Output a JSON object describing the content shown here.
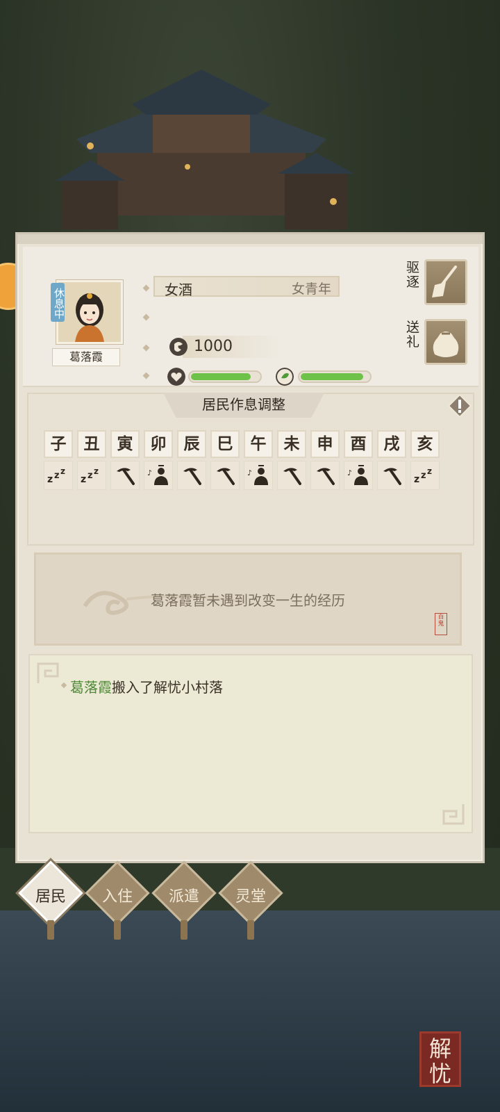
{
  "resident": {
    "status_tag": "休息中",
    "name": "葛落霞",
    "occupation": "女酒",
    "age_gender": "女青年",
    "coins": "1000",
    "health_fraction": 0.88,
    "mood_fraction": 0.92
  },
  "actions": {
    "expel_label": "驱逐",
    "gift_label": "送礼"
  },
  "schedule": {
    "title": "居民作息调整",
    "hours": [
      {
        "label": "子",
        "activity": "sleep"
      },
      {
        "label": "丑",
        "activity": "sleep"
      },
      {
        "label": "寅",
        "activity": "work"
      },
      {
        "label": "卯",
        "activity": "leisure"
      },
      {
        "label": "辰",
        "activity": "work"
      },
      {
        "label": "巳",
        "activity": "work"
      },
      {
        "label": "午",
        "activity": "leisure"
      },
      {
        "label": "未",
        "activity": "work"
      },
      {
        "label": "申",
        "activity": "work"
      },
      {
        "label": "酉",
        "activity": "leisure"
      },
      {
        "label": "戌",
        "activity": "work"
      },
      {
        "label": "亥",
        "activity": "sleep"
      }
    ]
  },
  "life_event": {
    "text": "葛落霞暂未遇到改变一生的经历",
    "seal": "百鬼"
  },
  "log": {
    "entries": [
      {
        "who": "葛落霞",
        "text": "搬入了解忧小村落"
      }
    ]
  },
  "tabs": [
    {
      "label": "居民",
      "active": true
    },
    {
      "label": "入住",
      "active": false
    },
    {
      "label": "派遣",
      "active": false
    },
    {
      "label": "灵堂",
      "active": false
    }
  ],
  "corner_logo": "解忧",
  "colors": {
    "bar_green": "#6ec24a",
    "log_name_green": "#4e8a36",
    "status_blue": "#6ea7c8"
  }
}
